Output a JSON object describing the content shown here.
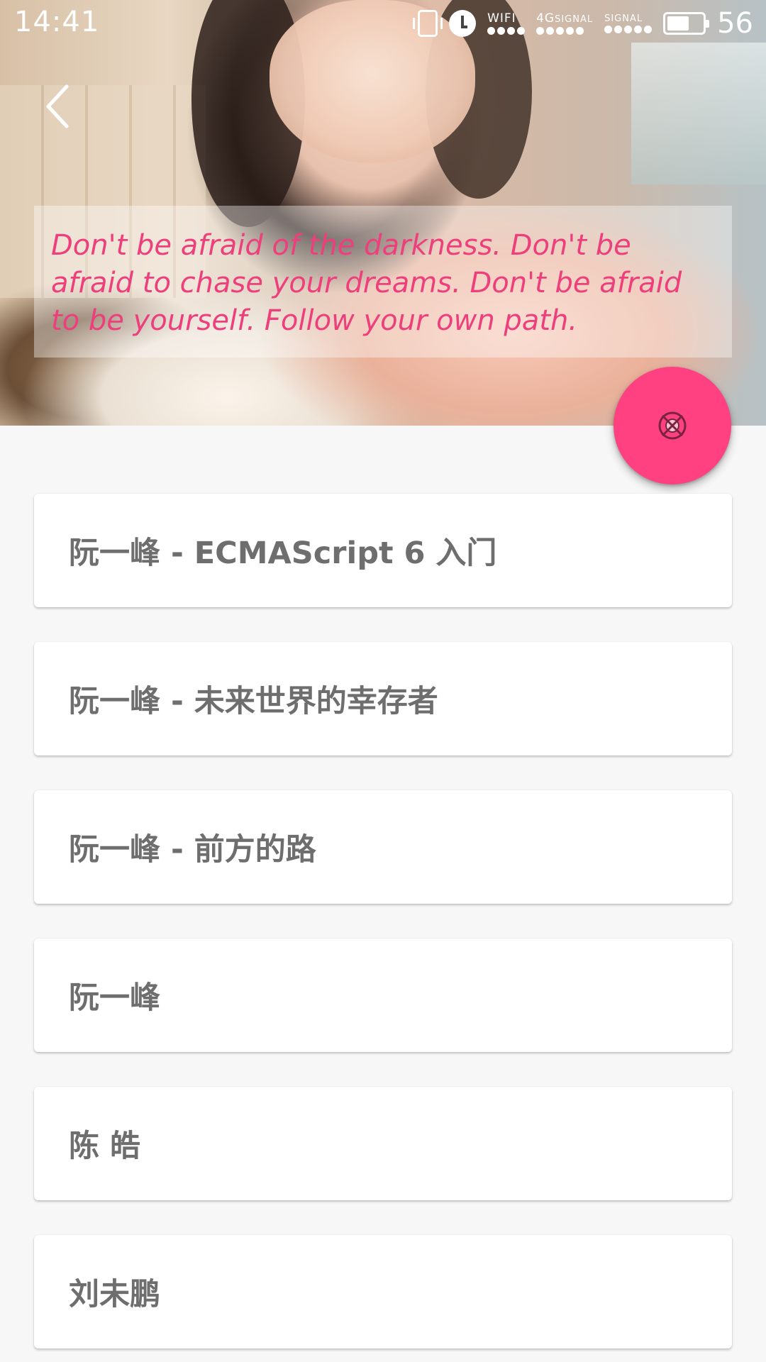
{
  "status_bar": {
    "time": "14:41",
    "wifi_label": "WIFI",
    "signal_4g_label": "4G",
    "signal_4g_sub": "SIGNAL",
    "signal_label": "SIGNAL",
    "battery_level": "56",
    "icons": [
      "vibrate-icon",
      "alarm-icon",
      "wifi-icon",
      "signal-4g-icon",
      "signal-icon",
      "battery-icon"
    ]
  },
  "header": {
    "back_icon": "chevron-left-icon",
    "quote": "Don't be afraid of the darkness. Don't be afraid to chase your dreams. Don't be afraid to be yourself. Follow your own path."
  },
  "fab": {
    "icon": "shuffle-target-icon",
    "color": "#ff4081"
  },
  "colors": {
    "accent": "#ff4081",
    "quote_text": "#ee3f7d",
    "card_text": "#6e6e6e",
    "background": "#f7f7f7"
  },
  "list": {
    "items": [
      {
        "title": "阮一峰 - ECMAScript 6 入门"
      },
      {
        "title": "阮一峰 - 未来世界的幸存者"
      },
      {
        "title": "阮一峰 - 前方的路"
      },
      {
        "title": "阮一峰"
      },
      {
        "title": "陈 皓"
      },
      {
        "title": "刘未鹏"
      }
    ]
  }
}
